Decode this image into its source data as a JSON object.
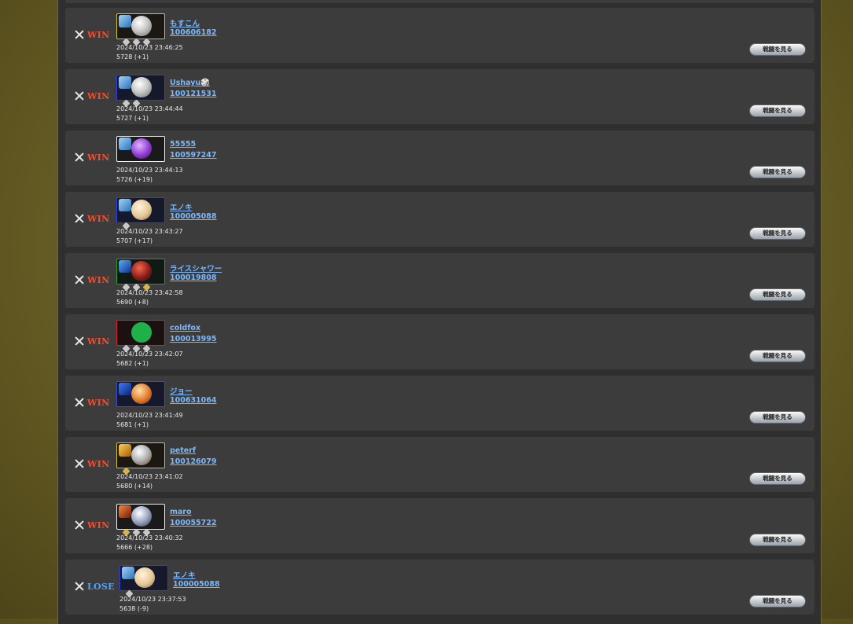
{
  "matches": [
    {
      "result": "WIN",
      "name": "もすこん",
      "id": "100606182",
      "datetime": "2024/10/23 23:46:25",
      "score": "5728 (+1)",
      "button": "戦闘を見る",
      "deck_color": "c-yellow"
    },
    {
      "result": "WIN",
      "name": "Ushayu🎲",
      "id": "100121531",
      "datetime": "2024/10/23 23:44:44",
      "score": "5727 (+1)",
      "button": "戦闘を見る",
      "deck_color": "c-blue"
    },
    {
      "result": "WIN",
      "name": "55555",
      "id": "100597247",
      "datetime": "2024/10/23 23:44:13",
      "score": "5726 (+19)",
      "button": "戦闘を見る",
      "deck_color": "c-white"
    },
    {
      "result": "WIN",
      "name": "エノキ",
      "id": "100005088",
      "datetime": "2024/10/23 23:43:27",
      "score": "5707 (+17)",
      "button": "戦闘を見る",
      "deck_color": "c-blue"
    },
    {
      "result": "WIN",
      "name": "ライスシャワー",
      "id": "100019808",
      "datetime": "2024/10/23 23:42:58",
      "score": "5690 (+8)",
      "button": "戦闘を見る",
      "deck_color": "c-green"
    },
    {
      "result": "WIN",
      "name": "coldfox",
      "id": "100013995",
      "datetime": "2024/10/23 23:42:07",
      "score": "5682 (+1)",
      "button": "戦闘を見る",
      "deck_color": "c-red"
    },
    {
      "result": "WIN",
      "name": "ジョー",
      "id": "100631064",
      "datetime": "2024/10/23 23:41:49",
      "score": "5681 (+1)",
      "button": "戦闘を見る",
      "deck_color": "c-navy"
    },
    {
      "result": "WIN",
      "name": "peterf",
      "id": "100126079",
      "datetime": "2024/10/23 23:41:02",
      "score": "5680 (+14)",
      "button": "戦闘を見る",
      "deck_color": "c-yellow"
    },
    {
      "result": "WIN",
      "name": "maro",
      "id": "100055722",
      "datetime": "2024/10/23 23:40:32",
      "score": "5666 (+28)",
      "button": "戦闘を見る",
      "deck_color": "c-white"
    },
    {
      "result": "LOSE",
      "name": "エノキ",
      "id": "100005088",
      "datetime": "2024/10/23 23:37:53",
      "score": "5638 (-9)",
      "button": "戦闘を見る",
      "deck_color": "c-blue"
    }
  ],
  "colors": {
    "win": "#ff4a2a",
    "lose": "#4fa3ff",
    "link": "#79b8ff",
    "row": "#3c3c3c",
    "panel": "#2f2f2f"
  }
}
